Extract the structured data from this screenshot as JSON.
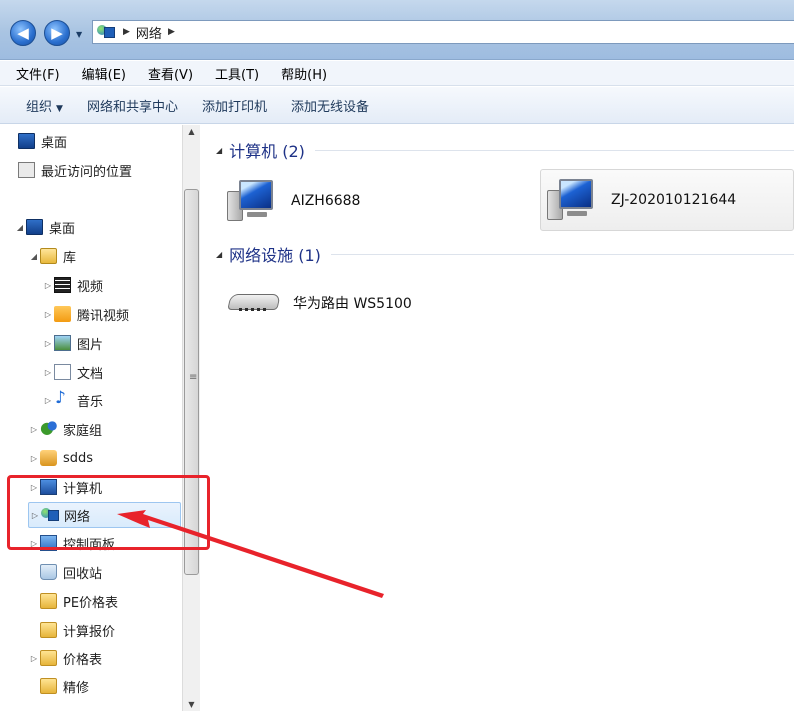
{
  "address_bar": {
    "breadcrumb": [
      "网络"
    ]
  },
  "menu_bar": {
    "items": [
      "文件(F)",
      "编辑(E)",
      "查看(V)",
      "工具(T)",
      "帮助(H)"
    ]
  },
  "command_bar": {
    "organize_label": "组织",
    "items": [
      "网络和共享中心",
      "添加打印机",
      "添加无线设备"
    ]
  },
  "sidebar": {
    "favorites": [
      {
        "label": "桌面",
        "icon": "desktop-icon"
      },
      {
        "label": "最近访问的位置",
        "icon": "recent-places-icon"
      }
    ],
    "tree": [
      {
        "label": "桌面",
        "icon": "desktop-icon",
        "expander": "expanded"
      },
      {
        "label": "库",
        "icon": "library-icon",
        "expander": "expanded"
      },
      {
        "label": "视频",
        "icon": "video-icon",
        "expander": "collapsed"
      },
      {
        "label": "腾讯视频",
        "icon": "tencent-video-icon",
        "expander": "collapsed"
      },
      {
        "label": "图片",
        "icon": "picture-icon",
        "expander": "collapsed"
      },
      {
        "label": "文档",
        "icon": "document-icon",
        "expander": "collapsed"
      },
      {
        "label": "音乐",
        "icon": "music-icon",
        "expander": "collapsed"
      },
      {
        "label": "家庭组",
        "icon": "homegroup-icon",
        "expander": "collapsed"
      },
      {
        "label": "sdds",
        "icon": "user-folder-icon",
        "expander": "collapsed"
      },
      {
        "label": "计算机",
        "icon": "computer-icon",
        "expander": "collapsed"
      },
      {
        "label": "网络",
        "icon": "network-icon",
        "expander": "collapsed",
        "selected": true
      },
      {
        "label": "控制面板",
        "icon": "control-panel-icon",
        "expander": "collapsed"
      },
      {
        "label": "回收站",
        "icon": "recycle-bin-icon",
        "expander": "none"
      },
      {
        "label": "PE价格表",
        "icon": "folder-icon",
        "expander": "none"
      },
      {
        "label": "计算报价",
        "icon": "folder-icon",
        "expander": "none"
      },
      {
        "label": "价格表",
        "icon": "folder-icon",
        "expander": "collapsed"
      },
      {
        "label": "精修",
        "icon": "folder-icon",
        "expander": "none"
      }
    ]
  },
  "main": {
    "groups": [
      {
        "title": "计算机 (2)",
        "items": [
          {
            "label": "AIZH6688",
            "icon": "network-computer-icon"
          },
          {
            "label": "ZJ-202010121644",
            "icon": "network-computer-icon"
          }
        ]
      },
      {
        "title": "网络设施 (1)",
        "items": [
          {
            "label": "华为路由 WS5100",
            "icon": "router-icon"
          }
        ]
      }
    ]
  },
  "annotation": {
    "color": "#e8232b"
  }
}
